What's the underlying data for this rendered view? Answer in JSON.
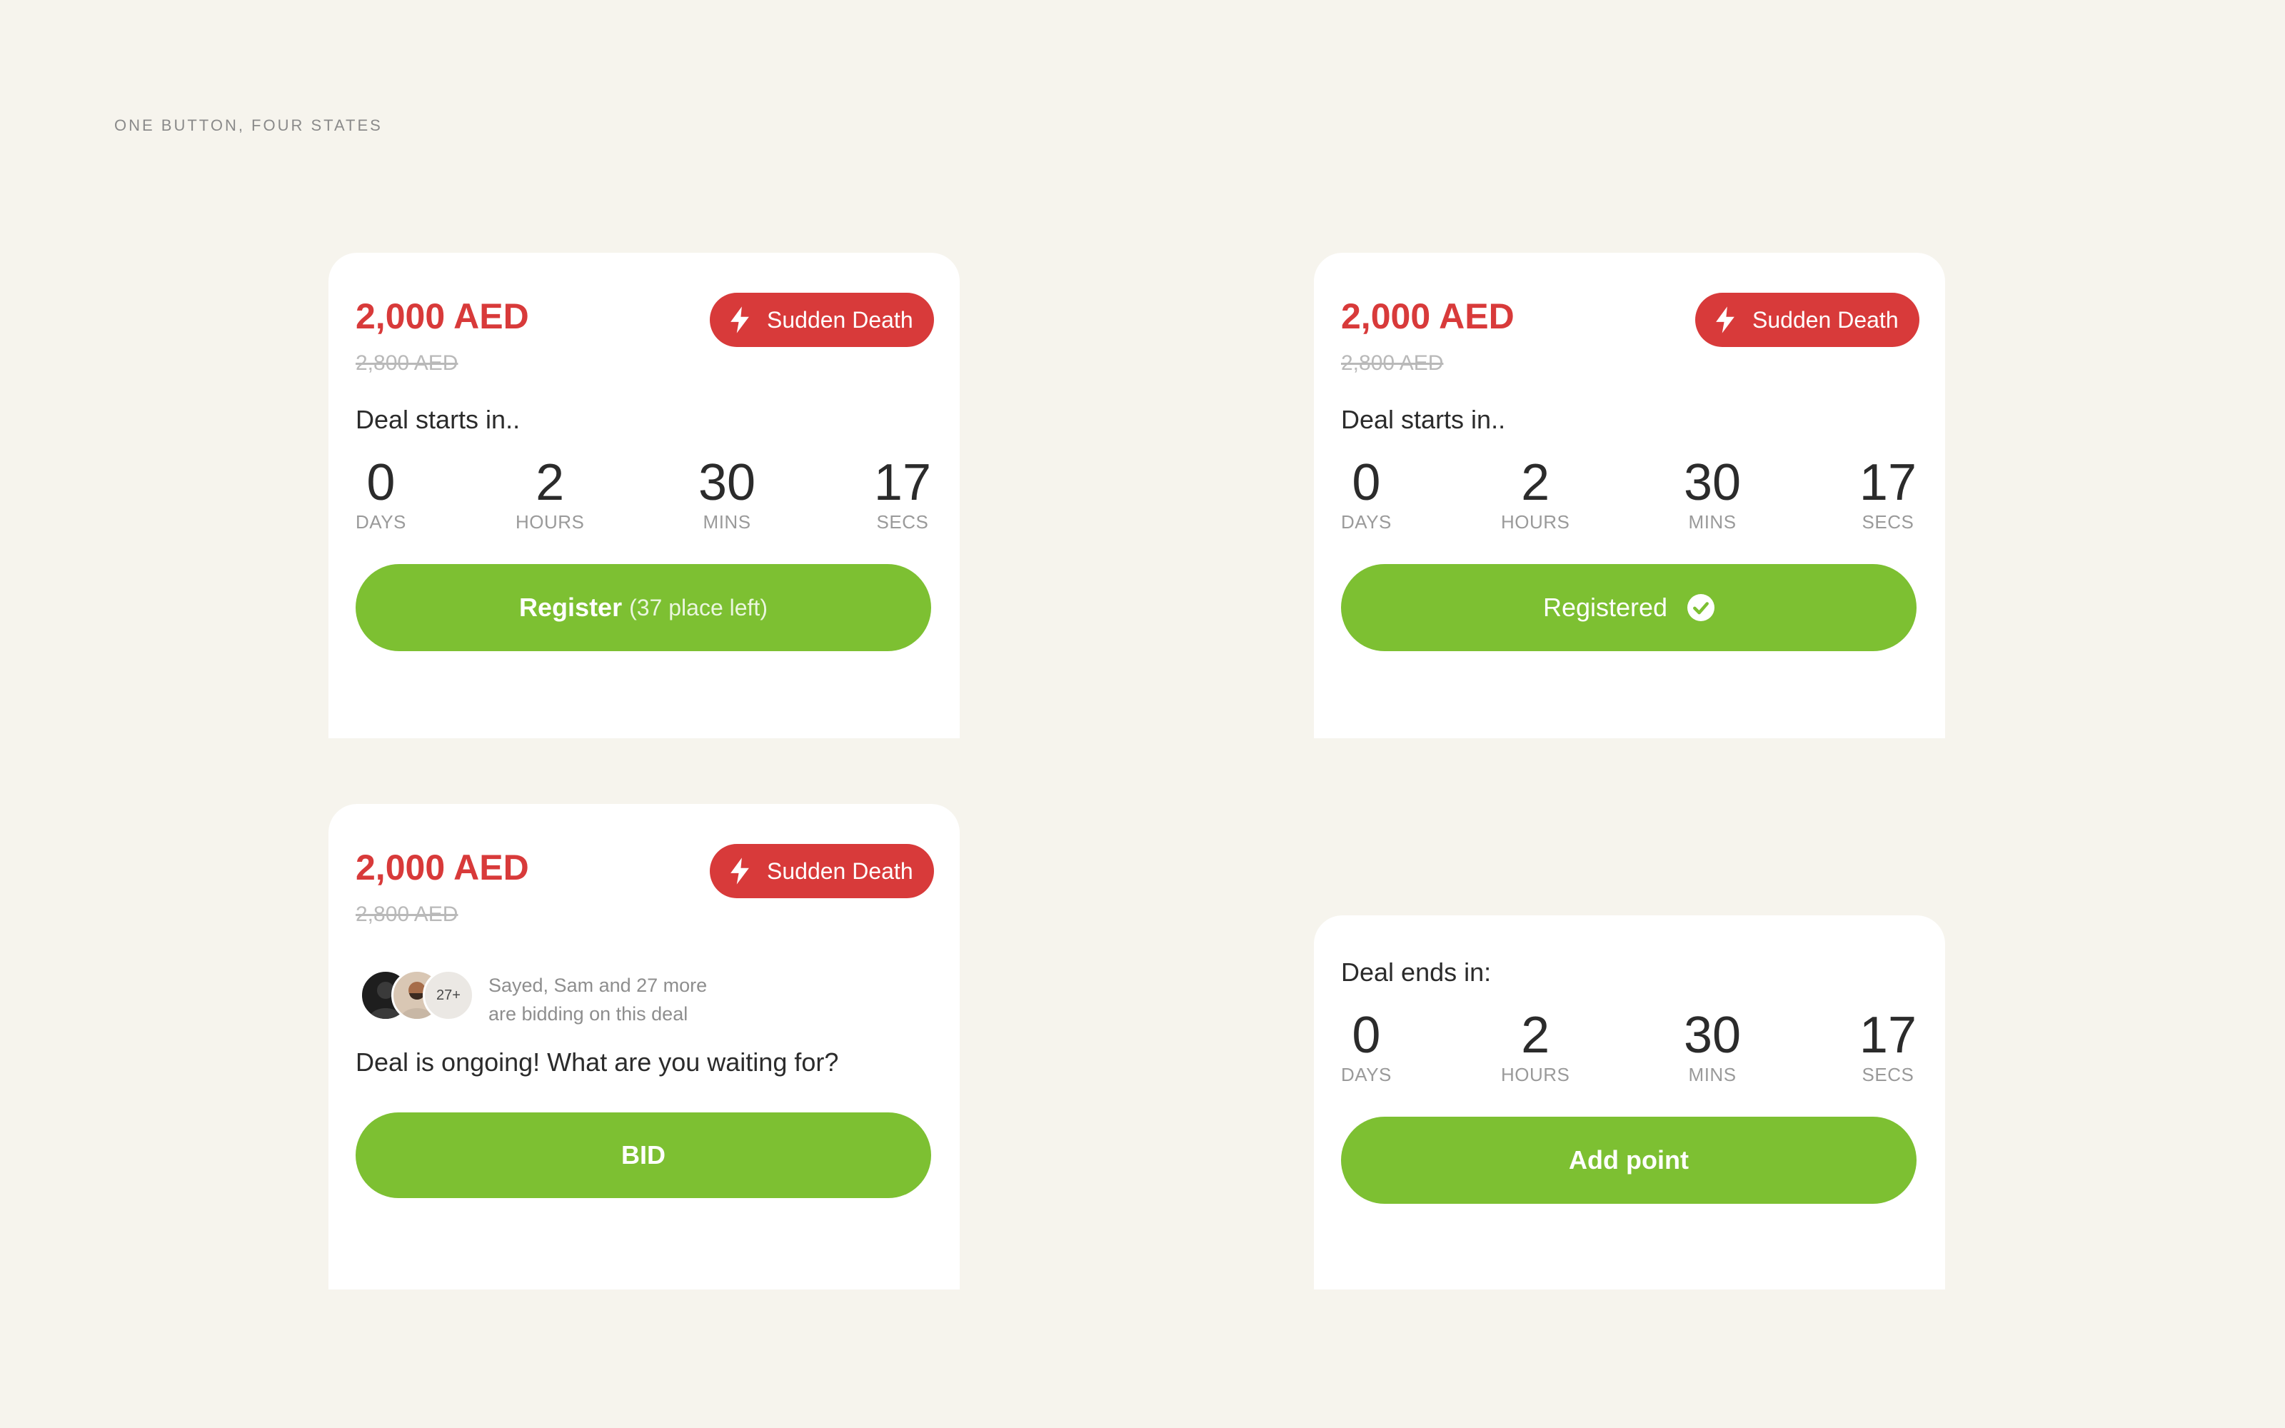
{
  "page": {
    "title": "ONE BUTTON, FOUR STATES"
  },
  "colors": {
    "background": "#f6f4ed",
    "price_red": "#d83a3a",
    "button_green": "#7dc032",
    "card": "#ffffff"
  },
  "cards": [
    {
      "price": "2,000 AED",
      "old_price": "2,800 AED",
      "badge": "Sudden Death",
      "badge_icon": "lightning-bolt-icon",
      "deal_text": "Deal starts in..",
      "countdown": [
        {
          "value": "0",
          "label": "DAYS"
        },
        {
          "value": "2",
          "label": "HOURS"
        },
        {
          "value": "30",
          "label": "MINS"
        },
        {
          "value": "17",
          "label": "SECS"
        }
      ],
      "button": {
        "label": "Register",
        "sublabel": "(37 place left)"
      }
    },
    {
      "price": "2,000 AED",
      "old_price": "2,800 AED",
      "badge": "Sudden Death",
      "badge_icon": "lightning-bolt-icon",
      "deal_text": "Deal starts in..",
      "countdown": [
        {
          "value": "0",
          "label": "DAYS"
        },
        {
          "value": "2",
          "label": "HOURS"
        },
        {
          "value": "30",
          "label": "MINS"
        },
        {
          "value": "17",
          "label": "SECS"
        }
      ],
      "button": {
        "label": "Registered",
        "icon": "check-circle-icon"
      }
    },
    {
      "price": "2,000 AED",
      "old_price": "2,800 AED",
      "badge": "Sudden Death",
      "badge_icon": "lightning-bolt-icon",
      "bidders": {
        "more_count": "27+",
        "line1": "Sayed, Sam and 27 more",
        "line2": "are bidding on this deal"
      },
      "deal_text": "Deal is ongoing! What are you waiting for?",
      "button": {
        "label": "BID"
      }
    },
    {
      "deal_text": "Deal ends in:",
      "countdown": [
        {
          "value": "0",
          "label": "DAYS"
        },
        {
          "value": "2",
          "label": "HOURS"
        },
        {
          "value": "30",
          "label": "MINS"
        },
        {
          "value": "17",
          "label": "SECS"
        }
      ],
      "button": {
        "label": "Add point"
      }
    }
  ]
}
